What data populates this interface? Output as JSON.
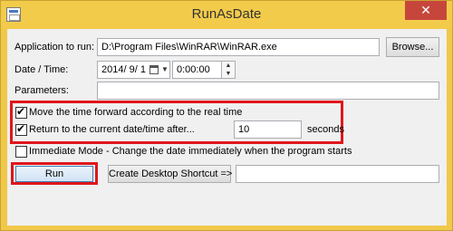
{
  "window": {
    "title": "RunAsDate",
    "close_glyph": "✕"
  },
  "form": {
    "app_label": "Application to run:",
    "app_value": "D:\\Program Files\\WinRAR\\WinRAR.exe",
    "browse_label": "Browse...",
    "date_label": "Date / Time:",
    "date_value": "2014/ 9/ 1",
    "time_value": "0:00:00",
    "params_label": "Parameters:",
    "params_value": "",
    "move_forward_label": "Move the time forward according to the real time",
    "move_forward_checked": true,
    "return_label": "Return to the current date/time after...",
    "return_checked": true,
    "return_seconds": "10",
    "seconds_label": "seconds",
    "immediate_label": "Immediate Mode - Change the date immediately when the program starts",
    "immediate_checked": false,
    "run_label": "Run",
    "shortcut_label": "Create Desktop Shortcut =>",
    "shortcut_value": ""
  },
  "colors": {
    "highlight": "#e0161b",
    "titlebar": "#f3cb4b",
    "close": "#c7463c"
  }
}
